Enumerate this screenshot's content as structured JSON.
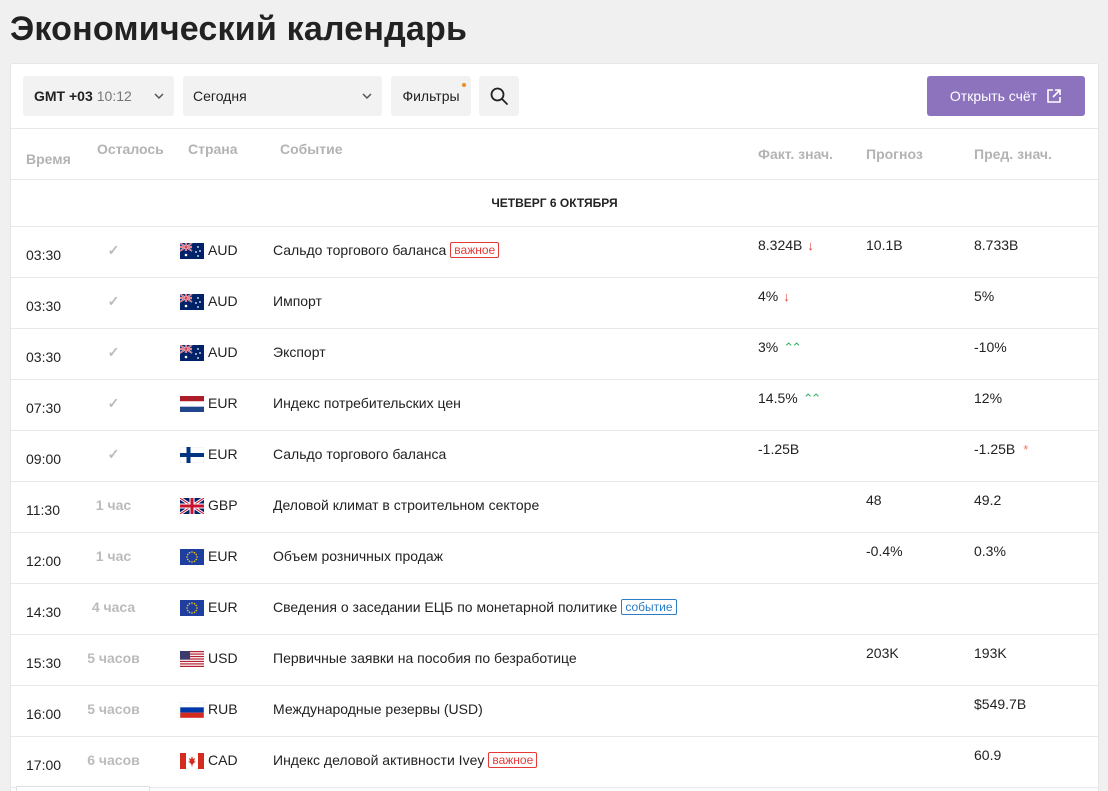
{
  "page": {
    "title": "Экономический календарь"
  },
  "toolbar": {
    "timezone": "GMT +03",
    "time": "10:12",
    "day": "Сегодня",
    "filters": "Фильтры",
    "search_icon": "search-icon",
    "open_account": "Открыть счёт",
    "accent_color": "#8d73bd"
  },
  "columns": {
    "time": "Время",
    "left": "Осталось",
    "country": "Страна",
    "event": "Событие",
    "actual": "Факт. знач.",
    "forecast": "Прогноз",
    "previous": "Пред. знач."
  },
  "date_header": "ЧЕТВЕРГ 6 ОКТЯБРЯ",
  "rows": [
    {
      "time": "03:30",
      "left": "✓",
      "flag": "au",
      "currency": "AUD",
      "event": "Сальдо торгового баланса",
      "tag": "важное",
      "tag_type": "imp",
      "actual": "8.324B",
      "trend": "↓",
      "trend_type": "down",
      "forecast": "10.1B",
      "previous": "8.733B",
      "star": ""
    },
    {
      "time": "03:30",
      "left": "✓",
      "flag": "au",
      "currency": "AUD",
      "event": "Импорт",
      "tag": "",
      "tag_type": "",
      "actual": "4%",
      "trend": "↓",
      "trend_type": "down",
      "forecast": "",
      "previous": "5%",
      "star": ""
    },
    {
      "time": "03:30",
      "left": "✓",
      "flag": "au",
      "currency": "AUD",
      "event": "Экспорт",
      "tag": "",
      "tag_type": "",
      "actual": "3%",
      "trend": "⌃⌃",
      "trend_type": "up",
      "forecast": "",
      "previous": "-10%",
      "star": ""
    },
    {
      "time": "07:30",
      "left": "✓",
      "flag": "nl",
      "currency": "EUR",
      "event": "Индекс потребительских цен",
      "tag": "",
      "tag_type": "",
      "actual": "14.5%",
      "trend": "⌃⌃",
      "trend_type": "up",
      "forecast": "",
      "previous": "12%",
      "star": ""
    },
    {
      "time": "09:00",
      "left": "✓",
      "flag": "fi",
      "currency": "EUR",
      "event": "Сальдо торгового баланса",
      "tag": "",
      "tag_type": "",
      "actual": "-1.25B",
      "trend": "",
      "trend_type": "",
      "forecast": "",
      "previous": "-1.25B",
      "star": "*"
    },
    {
      "time": "11:30",
      "left": "1 час",
      "flag": "gb",
      "currency": "GBP",
      "event": "Деловой климат в строительном секторе",
      "tag": "",
      "tag_type": "",
      "actual": "",
      "trend": "",
      "trend_type": "",
      "forecast": "48",
      "previous": "49.2",
      "star": ""
    },
    {
      "time": "12:00",
      "left": "1 час",
      "flag": "eu",
      "currency": "EUR",
      "event": "Объем розничных продаж",
      "tag": "",
      "tag_type": "",
      "actual": "",
      "trend": "",
      "trend_type": "",
      "forecast": "-0.4%",
      "previous": "0.3%",
      "star": ""
    },
    {
      "time": "14:30",
      "left": "4 часа",
      "flag": "eu",
      "currency": "EUR",
      "event": "Сведения о заседании ЕЦБ по монетарной политике",
      "tag": "событие",
      "tag_type": "evt",
      "actual": "",
      "trend": "",
      "trend_type": "",
      "forecast": "",
      "previous": "",
      "star": ""
    },
    {
      "time": "15:30",
      "left": "5 часов",
      "flag": "us",
      "currency": "USD",
      "event": "Первичные заявки на пособия по безработице",
      "tag": "",
      "tag_type": "",
      "actual": "",
      "trend": "",
      "trend_type": "",
      "forecast": "203K",
      "previous": "193K",
      "star": ""
    },
    {
      "time": "16:00",
      "left": "5 часов",
      "flag": "ru",
      "currency": "RUB",
      "event": "Международные резервы (USD)",
      "tag": "",
      "tag_type": "",
      "actual": "",
      "trend": "",
      "trend_type": "",
      "forecast": "",
      "previous": "$549.7B",
      "star": ""
    },
    {
      "time": "17:00",
      "left": "6 часов",
      "flag": "ca",
      "currency": "CAD",
      "event": "Индекс деловой активности Ivey",
      "tag": "важное",
      "tag_type": "imp",
      "actual": "",
      "trend": "",
      "trend_type": "",
      "forecast": "",
      "previous": "60.9",
      "star": ""
    }
  ]
}
